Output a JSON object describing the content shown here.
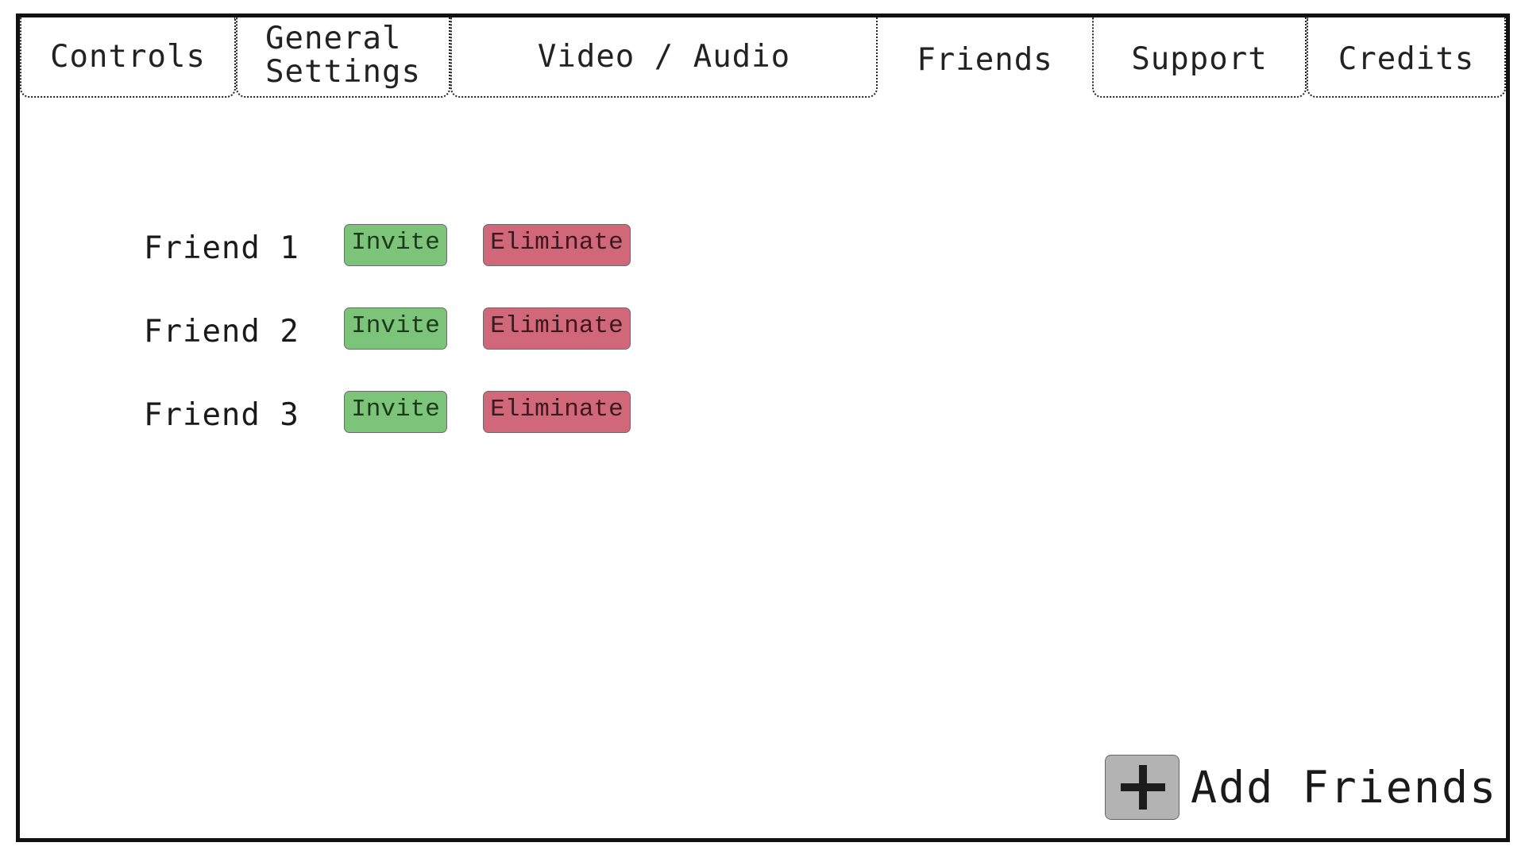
{
  "tabs": [
    {
      "id": "controls",
      "label": "Controls",
      "active": false
    },
    {
      "id": "general-settings",
      "label": "General\nSettings",
      "active": false
    },
    {
      "id": "video-audio",
      "label": "Video / Audio",
      "active": false
    },
    {
      "id": "friends",
      "label": "Friends",
      "active": true
    },
    {
      "id": "support",
      "label": "Support",
      "active": false
    },
    {
      "id": "credits",
      "label": "Credits",
      "active": false
    }
  ],
  "friends": [
    {
      "name": "Friend 1",
      "invite_label": "Invite",
      "eliminate_label": "Eliminate"
    },
    {
      "name": "Friend 2",
      "invite_label": "Invite",
      "eliminate_label": "Eliminate"
    },
    {
      "name": "Friend 3",
      "invite_label": "Invite",
      "eliminate_label": "Eliminate"
    }
  ],
  "add_friends": {
    "label": "Add Friends",
    "icon": "plus-icon"
  },
  "colors": {
    "invite": "#7cc479",
    "eliminate": "#d1687a",
    "add_icon_bg": "#b3b3b3",
    "frame_border": "#111111"
  }
}
